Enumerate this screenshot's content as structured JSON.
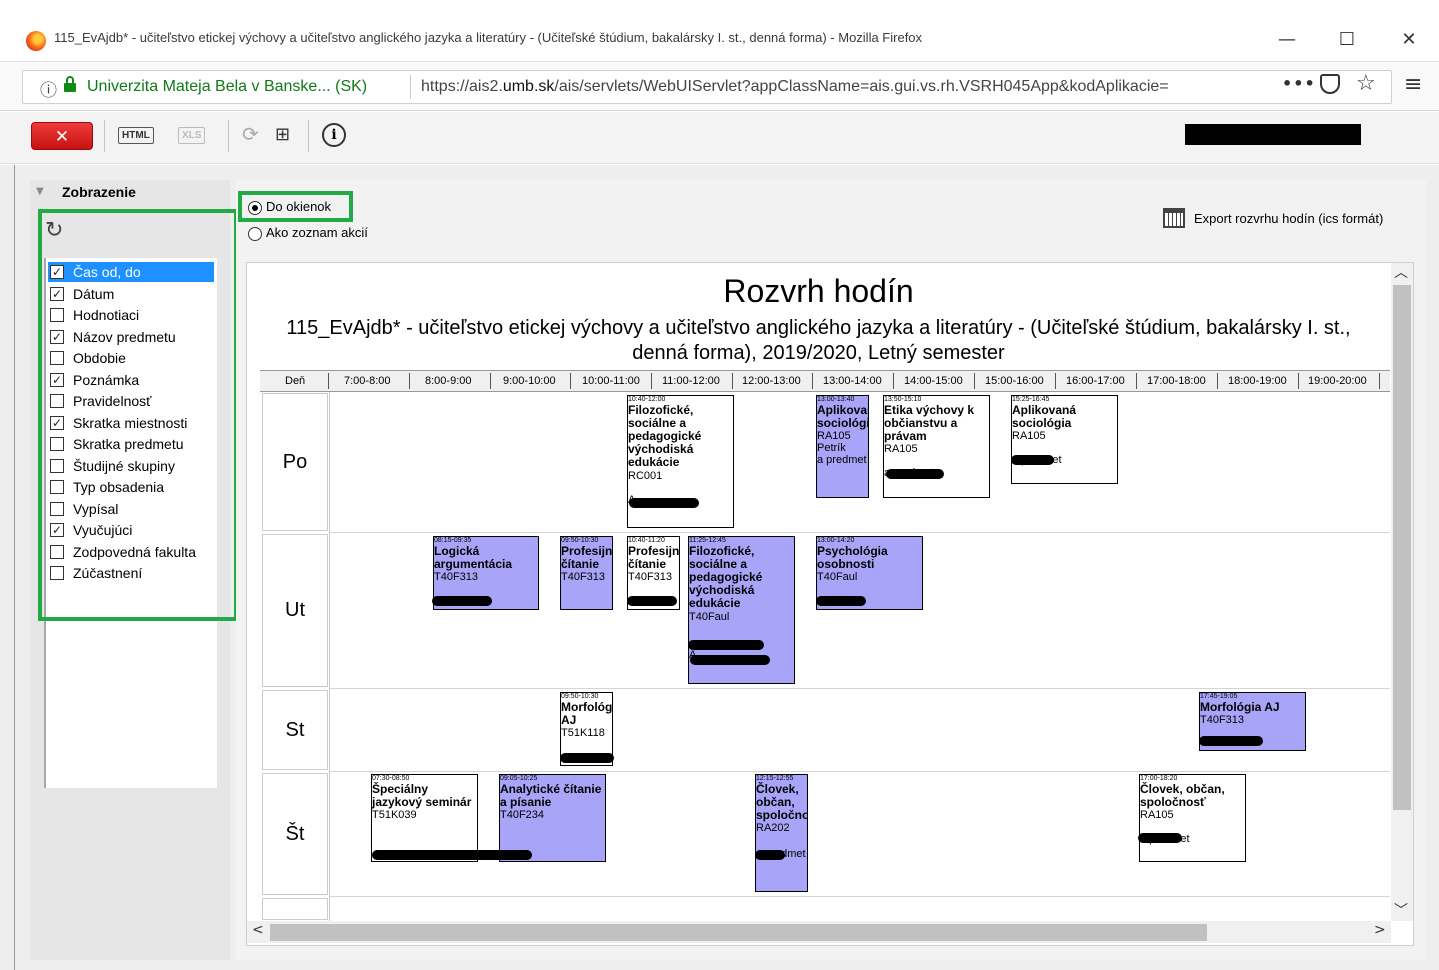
{
  "window": {
    "title": "115_EvAjdb* - učiteľstvo etickej výchovy a učiteľstvo anglického jazyka a literatúry - (Učiteľské štúdium, bakalársky I. st., denná forma) - Mozilla Firefox",
    "minimize": "—",
    "maximize": "☐",
    "close": "✕"
  },
  "urlbar": {
    "site_identity": "Univerzita Mateja Bela v Banske... (SK)",
    "url_prefix": "https://ais2.",
    "url_domain": "umb.sk",
    "url_rest": "/ais/servlets/WebUIServlet?appClassName=ais.gui.vs.rh.VSRH045App&kodAplikacie=",
    "more": "•••"
  },
  "toolbar": {
    "close_label": "✕",
    "html_label": "HTML",
    "xls_label": "XLS",
    "about_label": "i"
  },
  "sidebar": {
    "title": "Zobrazenie",
    "fields": [
      {
        "label": "Čas od, do",
        "checked": true,
        "selected": true
      },
      {
        "label": "Dátum",
        "checked": true
      },
      {
        "label": "Hodnotiaci",
        "checked": false
      },
      {
        "label": "Názov predmetu",
        "checked": true
      },
      {
        "label": "Obdobie",
        "checked": false
      },
      {
        "label": "Poznámka",
        "checked": true
      },
      {
        "label": "Pravidelnosť",
        "checked": false
      },
      {
        "label": "Skratka miestnosti",
        "checked": true
      },
      {
        "label": "Skratka predmetu",
        "checked": false
      },
      {
        "label": "Študijné skupiny",
        "checked": false
      },
      {
        "label": "Typ obsadenia",
        "checked": false
      },
      {
        "label": "Vypísal",
        "checked": false
      },
      {
        "label": "Vyučujúci",
        "checked": true
      },
      {
        "label": "Zodpovedná fakulta",
        "checked": false
      },
      {
        "label": "Zúčastnení",
        "checked": false
      }
    ]
  },
  "view_options": {
    "option_windows": "Do okienok",
    "option_list": "Ako zoznam akcií",
    "selected": "Do okienok",
    "export_label": "Export rozvrhu hodín (ics formát)"
  },
  "schedule": {
    "title": "Rozvrh hodín",
    "subtitle": "115_EvAjdb* - učiteľstvo etickej výchovy a učiteľstvo anglického jazyka a literatúry - (Učiteľské štúdium, bakalársky I. st., denná forma), 2019/2020, Letný semester",
    "day_header": "Deň",
    "time_slots": [
      "7:00-8:00",
      "8:00-9:00",
      "9:00-10:00",
      "10:00-11:00",
      "11:00-12:00",
      "12:00-13:00",
      "13:00-14:00",
      "14:00-15:00",
      "15:00-16:00",
      "16:00-17:00",
      "17:00-18:00",
      "18:00-19:00",
      "19:00-20:00"
    ],
    "days": [
      "Po",
      "Ut",
      "St",
      "Št"
    ],
    "events": {
      "po1": {
        "time": "10:40-12:00",
        "name": "Filozofické, sociálne a pedagogické východiská edukácie",
        "room": "RC001",
        "extra": "A"
      },
      "po2": {
        "time": "13:00-13:40",
        "name": "Aplikovaná sociológia",
        "room": "RA105",
        "teacher": "Petrík",
        "extra": "a predmet"
      },
      "po3": {
        "time": "13:50-15:10",
        "name": "Etika výchovy k občianstvu a právam",
        "room": "RA105",
        "extra": "a predmet"
      },
      "po4": {
        "time": "15:25-16:45",
        "name": "Aplikovaná sociológia",
        "room": "RA105",
        "extra": "a predmet"
      },
      "ut1": {
        "time": "08:15-09:35",
        "name": "Logická argumentácia",
        "room": "T40F313"
      },
      "ut2": {
        "time": "09:50-10:30",
        "name": "Profesijné čítanie",
        "room": "T40F313"
      },
      "ut3": {
        "time": "10:40-11:20",
        "name": "Profesijné čítanie",
        "room": "T40F313"
      },
      "ut4": {
        "time": "11:25-12:45",
        "name": "Filozofické, sociálne a pedagogické východiská edukácie",
        "room": "T40Faul",
        "extra": "A"
      },
      "ut5": {
        "time": "13:00-14:20",
        "name": "Psychológia osobnosti",
        "room": "T40Faul"
      },
      "st1": {
        "time": "09:50-10:30",
        "name": "Morfológia AJ",
        "room": "T51K118"
      },
      "st2": {
        "time": "17:45-19:05",
        "name": "Morfológia AJ",
        "room": "T40F313"
      },
      "stv1": {
        "time": "07:30-08:50",
        "name": "Špeciálny jazykový seminár",
        "room": "T51K039"
      },
      "stv2": {
        "time": "09:05-10:25",
        "name": "Analytické čítanie a písanie",
        "room": "T40F234"
      },
      "stv3": {
        "time": "12:15-12:55",
        "name": "Človek, občan, spoločnosť",
        "room": "RA202",
        "extra": "a predmet"
      },
      "stv4": {
        "time": "17:00-18:20",
        "name": "Človek, občan, spoločnosť",
        "room": "RA105",
        "extra": "a predmet"
      }
    }
  },
  "colors": {
    "event_purple": "#a8a4f8",
    "highlight_green": "#22aa44",
    "selection_blue": "#1e90ff",
    "close_red": "#d62020"
  }
}
